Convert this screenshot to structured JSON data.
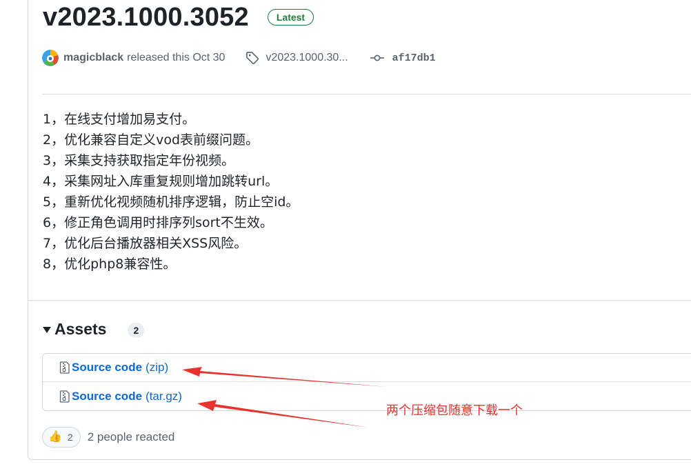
{
  "release": {
    "title": "v2023.1000.3052",
    "badge": "Latest",
    "author": "magicblack",
    "released_text": "released this Oct 30",
    "tag": "v2023.1000.30...",
    "commit": "af17db1"
  },
  "notes": [
    "1，在线支付增加易支付。",
    "2，优化兼容自定义vod表前缀问题。",
    "3，采集支持获取指定年份视频。",
    "4，采集网址入库重复规则增加跳转url。",
    "5，重新优化视频随机排序逻辑，防止空id。",
    "6，修正角色调用时排序列sort不生效。",
    "7，优化后台播放器相关XSS风险。",
    "8，优化php8兼容性。"
  ],
  "assets": {
    "title": "Assets",
    "count": "2",
    "items": [
      {
        "name": "Source code",
        "ext": "(zip)"
      },
      {
        "name": "Source code",
        "ext": "(tar.gz)"
      }
    ]
  },
  "annotation": {
    "text": "两个压缩包随意下载一个",
    "color": "#e8332c"
  },
  "reactions": {
    "emoji": "👍",
    "count": "2",
    "text": "2 people reacted"
  }
}
